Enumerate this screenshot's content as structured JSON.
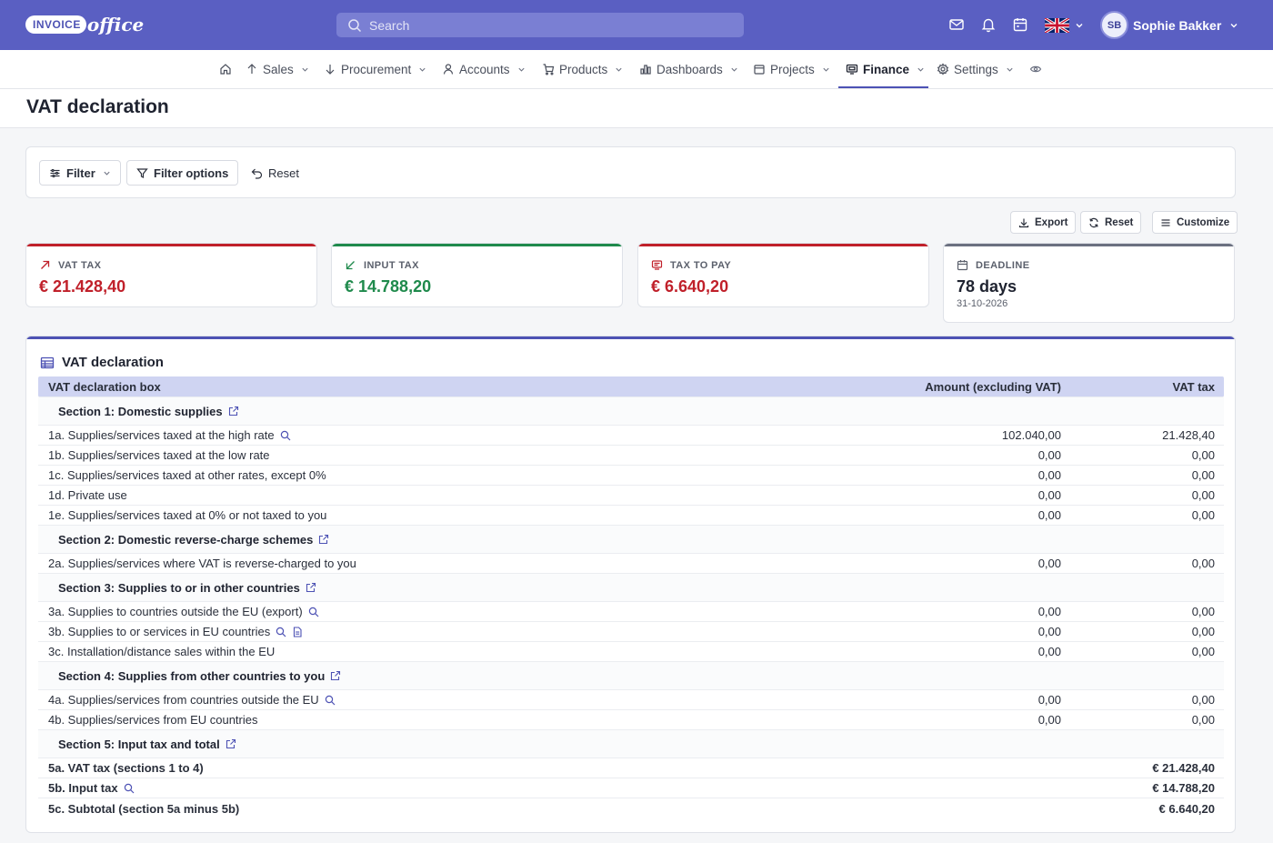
{
  "brand": {
    "logo_a": "INVOICE",
    "logo_b": "office"
  },
  "search": {
    "placeholder": "Search"
  },
  "user": {
    "initials": "SB",
    "name": "Sophie Bakker"
  },
  "colors": {
    "primary": "#5a5fc2",
    "red": "#c0202a",
    "green": "#1f8a4c",
    "gray": "#6b7080"
  },
  "nav": [
    {
      "label": "Sales"
    },
    {
      "label": "Procurement"
    },
    {
      "label": "Accounts"
    },
    {
      "label": "Products"
    },
    {
      "label": "Dashboards"
    },
    {
      "label": "Projects"
    },
    {
      "label": "Finance"
    },
    {
      "label": "Settings"
    }
  ],
  "page": {
    "title": "VAT declaration"
  },
  "filters": {
    "filter": "Filter",
    "filter_options": "Filter options",
    "reset": "Reset"
  },
  "actions": {
    "export": "Export",
    "reset": "Reset",
    "customize": "Customize"
  },
  "kpis": [
    {
      "label": "VAT TAX",
      "value": "€ 21.428,40",
      "sub": ""
    },
    {
      "label": "INPUT TAX",
      "value": "€ 14.788,20",
      "sub": ""
    },
    {
      "label": "TAX TO PAY",
      "value": "€ 6.640,20",
      "sub": ""
    },
    {
      "label": "DEADLINE",
      "value": "78 days",
      "sub": "31-10-2026"
    }
  ],
  "vat": {
    "title": "VAT declaration",
    "headers": {
      "box": "VAT declaration box",
      "amount": "Amount (excluding VAT)",
      "tax": "VAT tax"
    },
    "rows": [
      {
        "label": "Section 1: Domestic supplies"
      },
      {
        "label": "1a. Supplies/services taxed at the high rate",
        "amount": "102.040,00",
        "tax": "21.428,40"
      },
      {
        "label": "1b. Supplies/services taxed at the low rate",
        "amount": "0,00",
        "tax": "0,00"
      },
      {
        "label": "1c. Supplies/services taxed at other rates, except 0%",
        "amount": "0,00",
        "tax": "0,00"
      },
      {
        "label": "1d. Private use",
        "amount": "0,00",
        "tax": "0,00"
      },
      {
        "label": "1e. Supplies/services taxed at 0% or not taxed to you",
        "amount": "0,00",
        "tax": "0,00"
      },
      {
        "label": "Section 2: Domestic reverse-charge schemes"
      },
      {
        "label": "2a. Supplies/services where VAT is reverse-charged to you",
        "amount": "0,00",
        "tax": "0,00"
      },
      {
        "label": "Section 3: Supplies to or in other countries"
      },
      {
        "label": "3a. Supplies to countries outside the EU (export)",
        "amount": "0,00",
        "tax": "0,00"
      },
      {
        "label": "3b. Supplies to or services in EU countries",
        "amount": "0,00",
        "tax": "0,00"
      },
      {
        "label": "3c. Installation/distance sales within the EU",
        "amount": "0,00",
        "tax": "0,00"
      },
      {
        "label": "Section 4: Supplies from other countries to you"
      },
      {
        "label": "4a. Supplies/services from countries outside the EU",
        "amount": "0,00",
        "tax": "0,00"
      },
      {
        "label": "4b. Supplies/services from EU countries",
        "amount": "0,00",
        "tax": "0,00"
      },
      {
        "label": "Section 5: Input tax and total"
      },
      {
        "label": "5a. VAT tax (sections 1 to 4)",
        "amount": "",
        "tax": "€ 21.428,40"
      },
      {
        "label": "5b. Input tax",
        "amount": "",
        "tax": "€ 14.788,20"
      },
      {
        "label": "5c. Subtotal (section 5a minus 5b)",
        "amount": "",
        "tax": "€ 6.640,20"
      }
    ]
  }
}
